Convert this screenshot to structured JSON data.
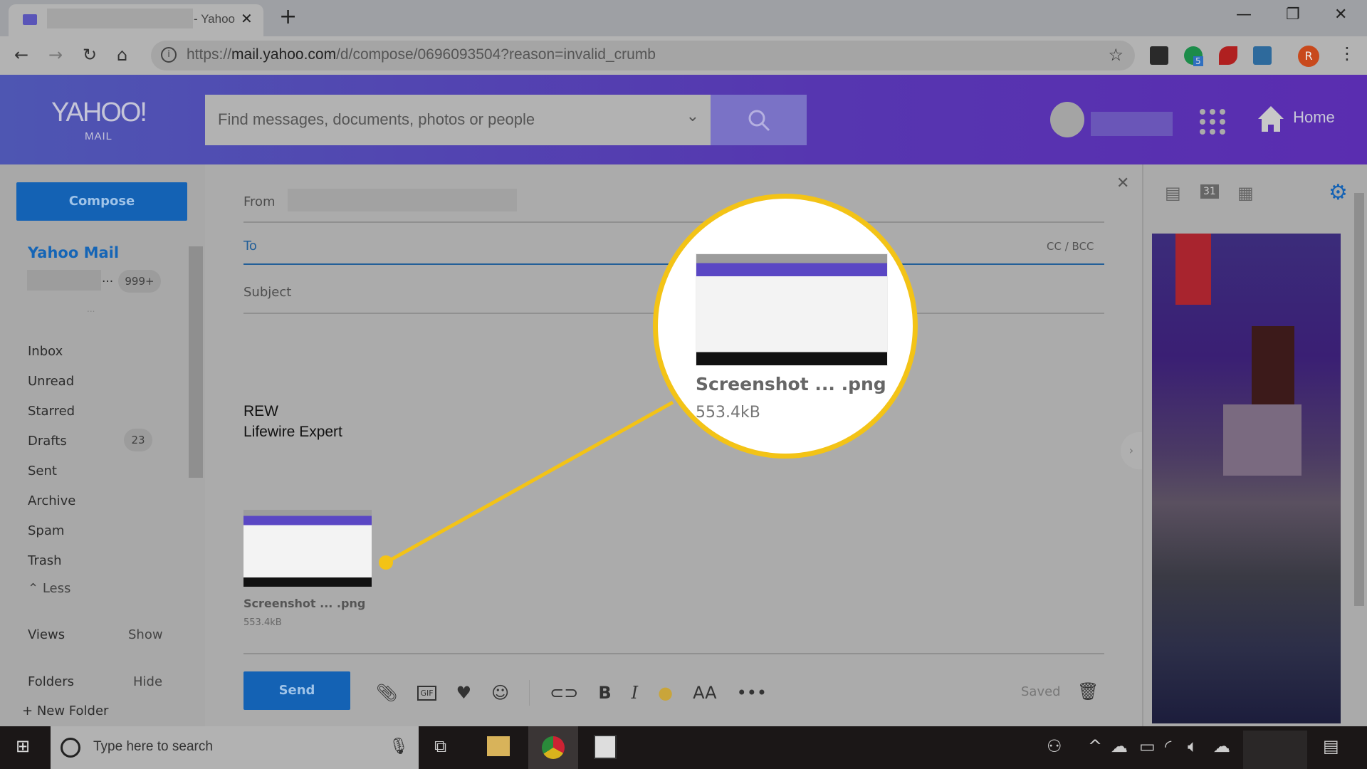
{
  "browser": {
    "tab_title": "- Yahoo",
    "url_prefix": "https://",
    "url_host": "mail.yahoo.com",
    "url_path": "/d/compose/0696093504?reason=invalid_crumb",
    "profile_initial": "R",
    "extension_badge": "5"
  },
  "header": {
    "logo": "YAHOO!",
    "logo_sub": "MAIL",
    "search_placeholder": "Find messages, documents, photos or people",
    "home_label": "Home"
  },
  "sidebar": {
    "compose": "Compose",
    "account_title": "Yahoo Mail",
    "account_ellipsis": "...",
    "account_badge": "999+",
    "more": "...",
    "folders": [
      {
        "label": "Inbox"
      },
      {
        "label": "Unread"
      },
      {
        "label": "Starred"
      },
      {
        "label": "Drafts",
        "count": "23"
      },
      {
        "label": "Sent"
      },
      {
        "label": "Archive"
      },
      {
        "label": "Spam"
      },
      {
        "label": "Trash"
      }
    ],
    "less": "Less",
    "views": "Views",
    "views_action": "Show",
    "folders_label": "Folders",
    "folders_action": "Hide",
    "new_folder": "New Folder"
  },
  "compose": {
    "from_label": "From",
    "to_label": "To",
    "cc_bcc": "CC / BCC",
    "subject_label": "Subject",
    "body_line1": "REW",
    "body_line2": "Lifewire Expert",
    "attachment": {
      "name": "Screenshot ... .png",
      "size": "553.4kB"
    },
    "send": "Send",
    "saved": "Saved"
  },
  "callout": {
    "name": "Screenshot ... .png",
    "size": "553.4kB",
    "color": "#f3c316"
  },
  "taskbar": {
    "search_placeholder": "Type here to search"
  },
  "colors": {
    "accent": "#1462b4",
    "header": "#5636b0"
  }
}
